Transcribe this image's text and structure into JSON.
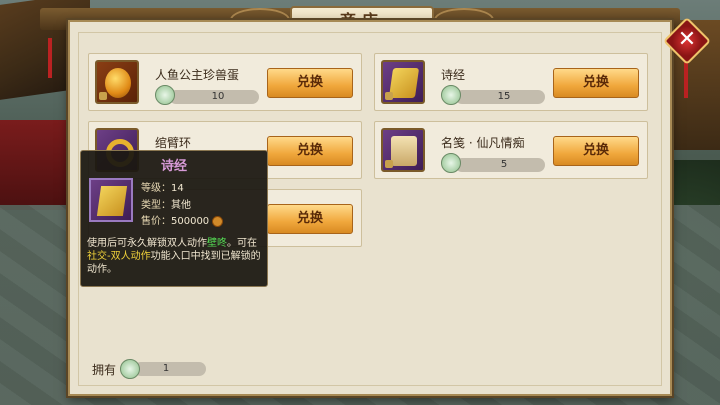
{
  "shop": {
    "title": "商店",
    "close_symbol": "✕"
  },
  "items": [
    {
      "name": "人鱼公主珍兽蛋",
      "price": "10",
      "button": "兑换",
      "icon": "egg-icon"
    },
    {
      "name": "诗经",
      "price": "15",
      "button": "兑换",
      "icon": "book-icon"
    },
    {
      "name": "绾臂环",
      "button": "兑换",
      "icon": "ring-icon"
    },
    {
      "name": "名笺 · 仙凡情痴",
      "price": "5",
      "button": "兑换",
      "icon": "scroll-icon"
    },
    {
      "button": "兑换"
    }
  ],
  "tooltip": {
    "title": "诗经",
    "level_label": "等级：",
    "level_value": "14",
    "type_label": "类型：",
    "type_value": "其他",
    "price_label": "售价：",
    "price_value": "500000",
    "desc_part1": "使用后可永久解锁双人动作",
    "desc_highlight1": "壁咚",
    "desc_part2": "。可在",
    "desc_highlight2": "社交-双人动作",
    "desc_part3": "功能入口中找到已解锁的动作。"
  },
  "footer": {
    "own_label": "拥有",
    "own_value": "1"
  },
  "colors": {
    "panel_bg": "#e9e2cf",
    "button": "#f0a73c",
    "tooltip_title": "#d79ad7",
    "highlight_green": "#55e055",
    "highlight_yellow": "#f0d23a"
  }
}
